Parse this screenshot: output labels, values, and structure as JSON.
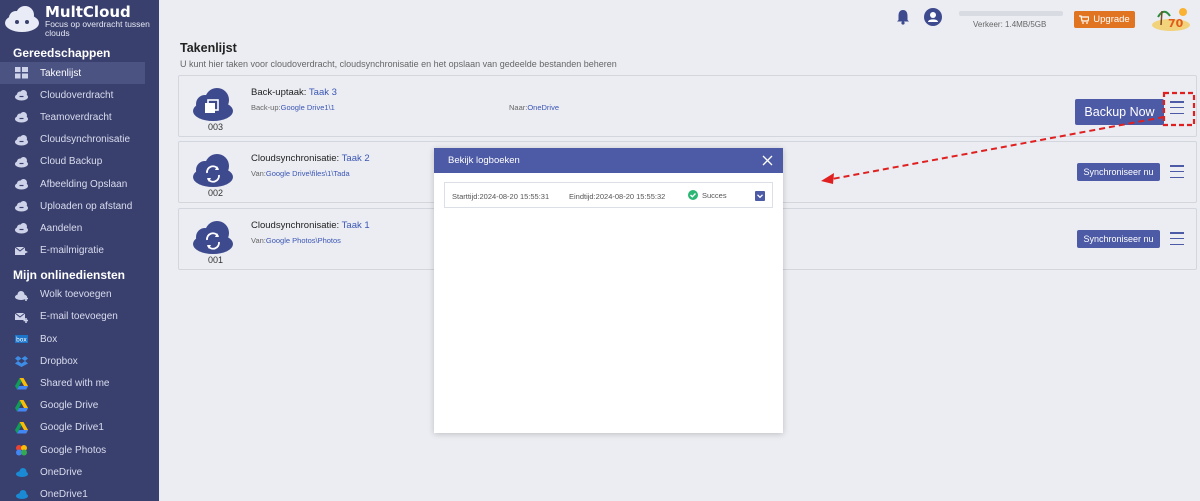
{
  "brand": {
    "name": "MultCloud",
    "tagline": "Focus op overdracht tussen clouds"
  },
  "sidebar": {
    "tools_title": "Gereedschappen",
    "tools": [
      {
        "label": "Takenlijst",
        "icon": "grid-icon"
      },
      {
        "label": "Cloudoverdracht",
        "icon": "cloud-transfer-icon"
      },
      {
        "label": "Teamoverdracht",
        "icon": "team-transfer-icon"
      },
      {
        "label": "Cloudsynchronisatie",
        "icon": "cloud-sync-icon"
      },
      {
        "label": "Cloud Backup",
        "icon": "cloud-backup-icon"
      },
      {
        "label": "Afbeelding Opslaan",
        "icon": "image-save-icon"
      },
      {
        "label": "Uploaden op afstand",
        "icon": "remote-upload-icon"
      },
      {
        "label": "Aandelen",
        "icon": "share-icon"
      },
      {
        "label": "E-mailmigratie",
        "icon": "email-migration-icon"
      }
    ],
    "services_title": "Mijn onlinediensten",
    "services": [
      {
        "label": "Wolk toevoegen",
        "icon": "add-cloud-icon"
      },
      {
        "label": "E-mail toevoegen",
        "icon": "add-email-icon"
      },
      {
        "label": "Box",
        "icon": "box-icon"
      },
      {
        "label": "Dropbox",
        "icon": "dropbox-icon"
      },
      {
        "label": "Shared with me",
        "icon": "google-drive-icon"
      },
      {
        "label": "Google Drive",
        "icon": "google-drive-icon"
      },
      {
        "label": "Google Drive1",
        "icon": "google-drive-icon"
      },
      {
        "label": "Google Photos",
        "icon": "google-photos-icon"
      },
      {
        "label": "OneDrive",
        "icon": "onedrive-icon"
      },
      {
        "label": "OneDrive1",
        "icon": "onedrive-icon"
      }
    ]
  },
  "header": {
    "traffic": "Verkeer: 1.4MB/5GB",
    "upgrade": "Upgrade",
    "badge": "70"
  },
  "main": {
    "title": "Takenlijst",
    "subtitle": "U kunt hier taken voor cloudoverdracht, cloudsynchronisatie en het opslaan van gedeelde bestanden beheren"
  },
  "tasks": [
    {
      "number": "003",
      "type": "Back-uptaak:",
      "name": "Taak 3",
      "src_prefix": "Back-up:",
      "src": "Google Drive1\\1",
      "dst_prefix": "Naar:",
      "dst": "OneDrive",
      "action": "Backup Now"
    },
    {
      "number": "002",
      "type": "Cloudsynchronisatie:",
      "name": "Taak 2",
      "src_prefix": "Van:",
      "src": "Google Drive\\files\\1\\Tada",
      "action": "Synchroniseer nu"
    },
    {
      "number": "001",
      "type": "Cloudsynchronisatie:",
      "name": "Taak 1",
      "src_prefix": "Van:",
      "src": "Google Photos\\Photos",
      "action": "Synchroniseer nu"
    }
  ],
  "modal": {
    "title": "Bekijk logboeken",
    "log": {
      "start": "Starttijd:2024-08-20 15:55:31",
      "end": "Eindtijd:2024-08-20 15:55:32",
      "status": "Succes"
    }
  },
  "colors": {
    "sidebar": "#39406d",
    "accent": "#4d5aa6",
    "upgrade": "#e07420",
    "success": "#2bb673",
    "annotation": "#e02020"
  }
}
